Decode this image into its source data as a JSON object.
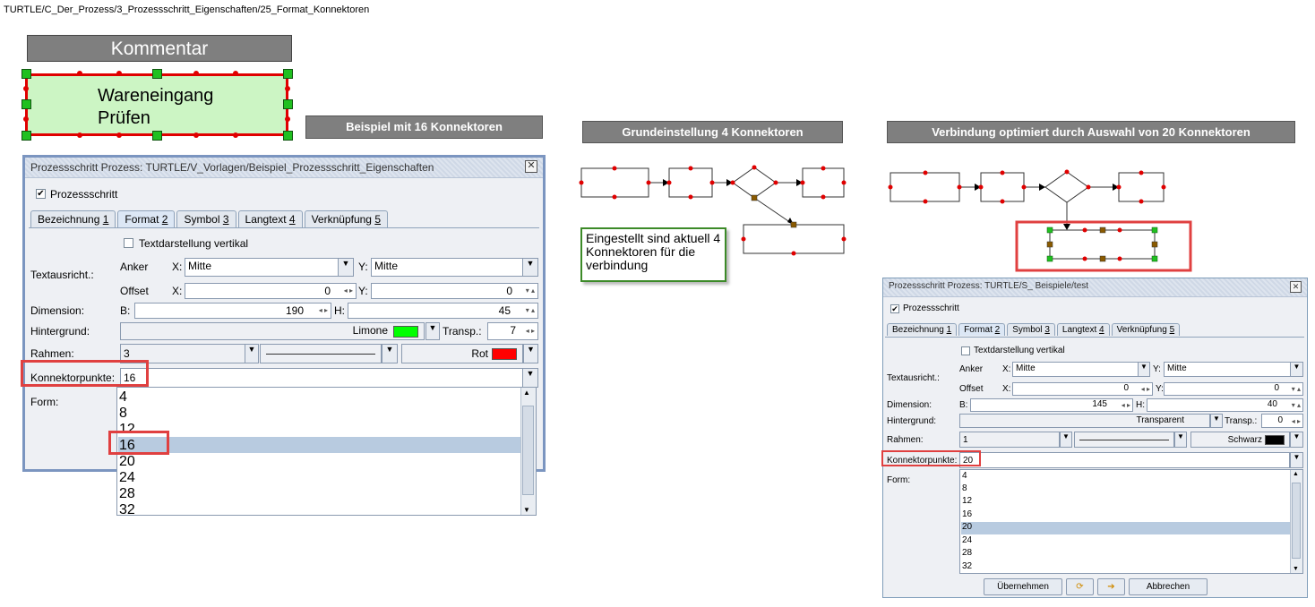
{
  "breadcrumb": "TURTLE/C_Der_Prozess/3_Prozessschritt_Eigenschaften/25_Format_Konnektoren",
  "comment_label": "Kommentar",
  "shape_text_1": "Wareneingang",
  "shape_text_2": "Prüfen",
  "headers": {
    "example16": "Beispiel mit 16 Konnektoren",
    "default4": "Grundeinstellung 4 Konnektoren",
    "optimized20": "Verbindung optimiert durch Auswahl von 20 Konnektoren"
  },
  "note": "Eingestellt sind aktuell 4 Konnektoren für die verbindung",
  "dialog1": {
    "title": "Prozessschritt Prozess: TURTLE/V_Vorlagen/Beispiel_Prozessschritt_Eigenschaften",
    "checkbox": "Prozessschritt",
    "tabs": [
      {
        "label": "Bezeichnung",
        "key": "1"
      },
      {
        "label": "Format",
        "key": "2"
      },
      {
        "label": "Symbol",
        "key": "3"
      },
      {
        "label": "Langtext",
        "key": "4"
      },
      {
        "label": "Verknüpfung",
        "key": "5"
      }
    ],
    "vertical_text": "Textdarstellung vertikal",
    "textausricht": "Textausricht.:",
    "anker": "Anker",
    "offset": "Offset",
    "x_label": "X:",
    "y_label": "Y:",
    "anker_x": "Mitte",
    "anker_y": "Mitte",
    "offset_x": "0",
    "offset_y": "0",
    "dimension": "Dimension:",
    "b_label": "B:",
    "h_label": "H:",
    "dim_b": "190",
    "dim_h": "45",
    "hintergrund": "Hintergrund:",
    "bg_color": "Limone",
    "transp_label": "Transp.:",
    "transp": "7",
    "rahmen": "Rahmen:",
    "rahmen_width": "3",
    "rahmen_color": "Rot",
    "konnektor_label": "Konnektorpunkte:",
    "konnektor_value": "16",
    "form": "Form:",
    "options": [
      "4",
      "8",
      "12",
      "16",
      "20",
      "24",
      "28",
      "32"
    ],
    "selected": "16"
  },
  "dialog2": {
    "title": "Prozessschritt Prozess: TURTLE/S_ Beispiele/test",
    "checkbox": "Prozessschritt",
    "tabs": [
      {
        "label": "Bezeichnung",
        "key": "1"
      },
      {
        "label": "Format",
        "key": "2"
      },
      {
        "label": "Symbol",
        "key": "3"
      },
      {
        "label": "Langtext",
        "key": "4"
      },
      {
        "label": "Verknüpfung",
        "key": "5"
      }
    ],
    "vertical_text": "Textdarstellung vertikal",
    "textausricht": "Textausricht.:",
    "anker": "Anker",
    "offset": "Offset",
    "x_label": "X:",
    "y_label": "Y:",
    "anker_x": "Mitte",
    "anker_y": "Mitte",
    "offset_x": "0",
    "offset_y": "0",
    "dimension": "Dimension:",
    "b_label": "B:",
    "h_label": "H:",
    "dim_b": "145",
    "dim_h": "40",
    "hintergrund": "Hintergrund:",
    "bg_color": "Transparent",
    "transp_label": "Transp.:",
    "transp": "0",
    "rahmen": "Rahmen:",
    "rahmen_width": "1",
    "rahmen_color": "Schwarz",
    "konnektor_label": "Konnektorpunkte:",
    "konnektor_value": "20",
    "form": "Form:",
    "options": [
      "4",
      "8",
      "12",
      "16",
      "20",
      "24",
      "28",
      "32"
    ],
    "selected": "20",
    "apply_button": "Übernehmen",
    "cancel_button": "Abbrechen"
  },
  "colors": {
    "green": "#20c020",
    "red": "#e00000",
    "limone": "#00ff00",
    "rot": "#ff0000",
    "schwarz": "#000000"
  }
}
